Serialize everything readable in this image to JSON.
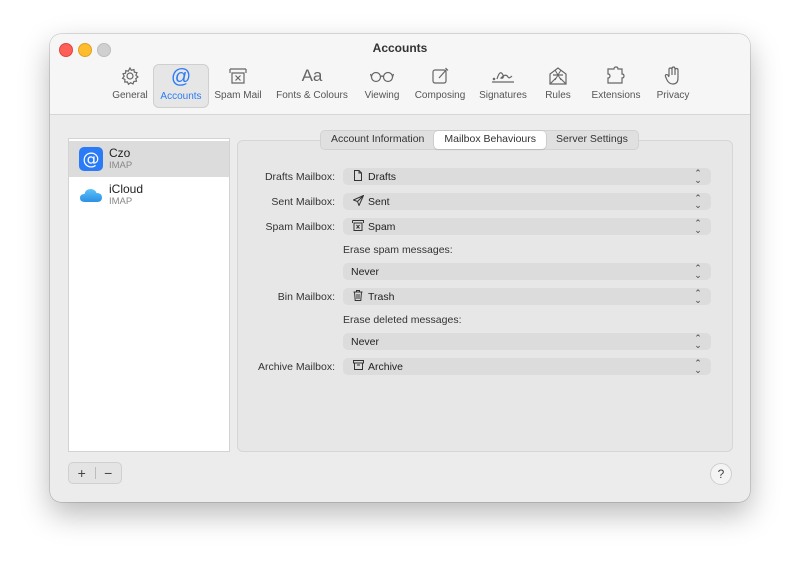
{
  "window": {
    "title": "Accounts"
  },
  "toolbar": [
    {
      "label": "General",
      "icon": "gear-icon"
    },
    {
      "label": "Accounts",
      "icon": "at-icon"
    },
    {
      "label": "Spam Mail",
      "icon": "spam-tray-icon"
    },
    {
      "label": "Fonts & Colours",
      "icon": "fonts-icon",
      "glyph": "Aa"
    },
    {
      "label": "Viewing",
      "icon": "glasses-icon"
    },
    {
      "label": "Composing",
      "icon": "compose-icon"
    },
    {
      "label": "Signatures",
      "icon": "signature-icon"
    },
    {
      "label": "Rules",
      "icon": "rules-envelope-icon"
    },
    {
      "label": "Extensions",
      "icon": "puzzle-icon"
    },
    {
      "label": "Privacy",
      "icon": "hand-icon"
    }
  ],
  "accounts": [
    {
      "name": "Czo",
      "type": "IMAP",
      "icon": "at-account-icon",
      "selected": true
    },
    {
      "name": "iCloud",
      "type": "IMAP",
      "icon": "icloud-icon",
      "selected": false
    }
  ],
  "tabs": [
    "Account Information",
    "Mailbox Behaviours",
    "Server Settings"
  ],
  "active_tab": "Mailbox Behaviours",
  "form": {
    "drafts": {
      "label": "Drafts Mailbox:",
      "value": "Drafts",
      "icon": "doc-icon"
    },
    "sent": {
      "label": "Sent Mailbox:",
      "value": "Sent",
      "icon": "paperplane-icon"
    },
    "spam": {
      "label": "Spam Mailbox:",
      "value": "Spam",
      "icon": "spam-tray-icon"
    },
    "erase_spam": {
      "label": "Erase spam messages:",
      "value": "Never"
    },
    "bin": {
      "label": "Bin Mailbox:",
      "value": "Trash",
      "icon": "trash-icon"
    },
    "erase_deleted": {
      "label": "Erase deleted messages:",
      "value": "Never"
    },
    "archive": {
      "label": "Archive Mailbox:",
      "value": "Archive",
      "icon": "archive-box-icon"
    }
  },
  "footer": {
    "add": "+",
    "remove": "−",
    "help": "?"
  },
  "colors": {
    "accent": "#2a7bf5",
    "close": "#fe5f57",
    "minimize": "#febc2e"
  }
}
